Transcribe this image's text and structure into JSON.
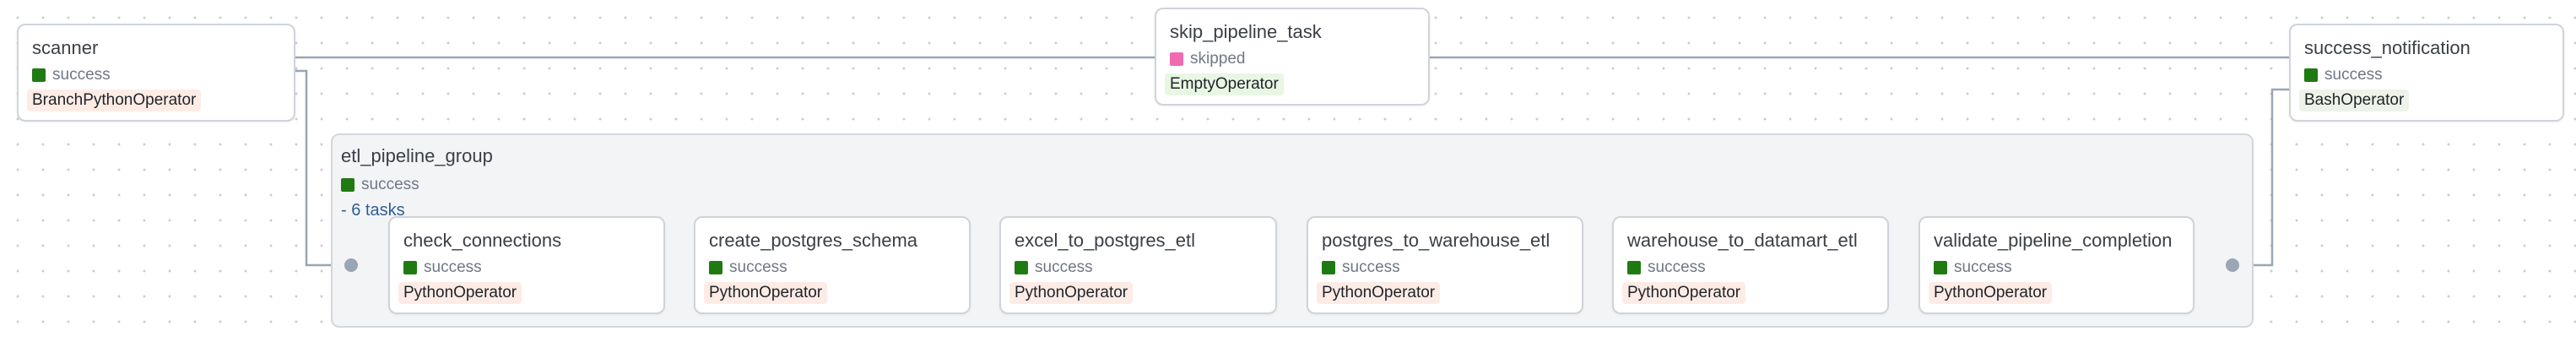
{
  "colors": {
    "success": "#1f7a12",
    "skipped": "#f06bb0",
    "python_operator_bg": "#fdece6",
    "branch_operator_bg": "#fdece6",
    "bash_operator_bg": "#eef3ea",
    "empty_operator_bg": "#e8f6e4",
    "edge": "#9aa6b3",
    "group_link": "#2e5d95"
  },
  "nodes": {
    "scanner": {
      "title": "scanner",
      "state": "success",
      "operator": "BranchPythonOperator"
    },
    "skip_pipeline_task": {
      "title": "skip_pipeline_task",
      "state": "skipped",
      "operator": "EmptyOperator"
    },
    "success_notification": {
      "title": "success_notification",
      "state": "success",
      "operator": "BashOperator"
    }
  },
  "group": {
    "title": "etl_pipeline_group",
    "state": "success",
    "task_count_label": "- 6 tasks",
    "tasks": [
      {
        "title": "check_connections",
        "state": "success",
        "operator": "PythonOperator"
      },
      {
        "title": "create_postgres_schema",
        "state": "success",
        "operator": "PythonOperator"
      },
      {
        "title": "excel_to_postgres_etl",
        "state": "success",
        "operator": "PythonOperator"
      },
      {
        "title": "postgres_to_warehouse_etl",
        "state": "success",
        "operator": "PythonOperator"
      },
      {
        "title": "warehouse_to_datamart_etl",
        "state": "success",
        "operator": "PythonOperator"
      },
      {
        "title": "validate_pipeline_completion",
        "state": "success",
        "operator": "PythonOperator"
      }
    ]
  }
}
